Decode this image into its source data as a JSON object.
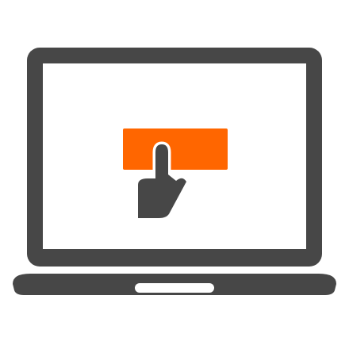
{
  "illustration": {
    "subject": "laptop-click-icon",
    "colors": {
      "body": "#474747",
      "screen": "#ffffff",
      "button": "#ff6600",
      "background": "#ffffff"
    },
    "icons": [
      "laptop-icon",
      "pointing-hand-icon",
      "screen-button"
    ]
  }
}
